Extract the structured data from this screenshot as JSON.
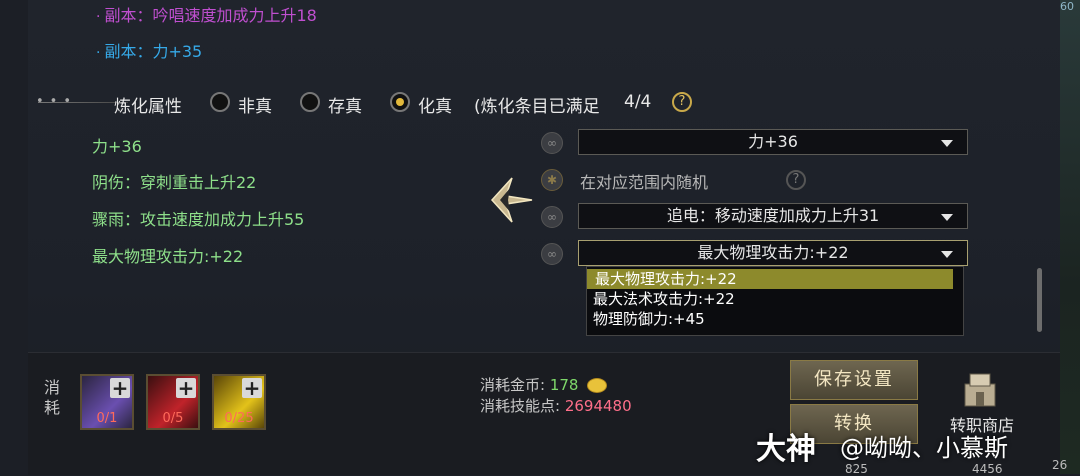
{
  "top_corner": "60",
  "copies": [
    {
      "text": "副本：吟唱速度加成力上升18"
    },
    {
      "text": "副本：力+35"
    }
  ],
  "refine": {
    "title": "炼化属性",
    "options": [
      "非真",
      "存真",
      "化真"
    ],
    "selected": "化真",
    "status_prefix": "(炼化条目已满足",
    "status_count": "4/4"
  },
  "attributes": [
    "力+36",
    "阴伤：穿刺重击上升22",
    "骤雨：攻击速度加成力上升55",
    "最大物理攻击力:+22"
  ],
  "random_text": "在对应范围内随机",
  "dropdowns": [
    "力+36",
    "追电：移动速度加成力上升31",
    "最大物理攻击力:+22"
  ],
  "open_list": [
    "最大物理攻击力:+22",
    "最大法术攻击力:+22",
    "物理防御力:+45"
  ],
  "consume": {
    "label": "消耗",
    "items": [
      {
        "count": "0/1",
        "color": "#6a4fb0"
      },
      {
        "count": "0/5",
        "color": "#c0232a"
      },
      {
        "count": "0/25",
        "color": "#e3c21a"
      }
    ],
    "gold_label": "消耗金币:",
    "gold_value": "178",
    "skill_label": "消耗技能点:",
    "skill_value": "2694480"
  },
  "buttons": {
    "save": "保存设置",
    "convert": "转换"
  },
  "shop": "转职商店",
  "watermark": {
    "brand": "大神",
    "user": "@呦呦、小慕斯"
  },
  "bottom_nums": [
    "825",
    "4456",
    "26"
  ]
}
